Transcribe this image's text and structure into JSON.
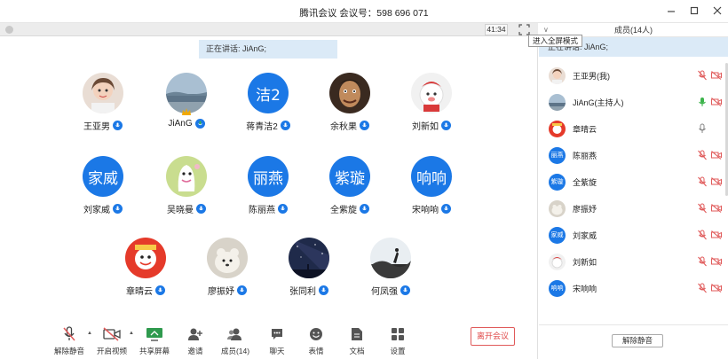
{
  "window": {
    "title": "腾讯会议  会议号：598 696 071"
  },
  "stage": {
    "timer": "41:34",
    "fullscreen_tooltip": "进入全屏模式",
    "speaking": "正在讲话: JiAnG;"
  },
  "participants": [
    {
      "name": "王亚男",
      "avatar": "photo-girl"
    },
    {
      "name": "JiAnG",
      "avatar": "photo-sea"
    },
    {
      "name": "蒋青洁2",
      "avatar_text": "洁2"
    },
    {
      "name": "余秋果",
      "avatar": "photo-man"
    },
    {
      "name": "刘新如",
      "avatar": "photo-lion"
    },
    {
      "name": "刘家威",
      "avatar_text": "家威"
    },
    {
      "name": "吴晓曼",
      "avatar": "photo-cartoon"
    },
    {
      "name": "陈丽燕",
      "avatar_text": "丽燕"
    },
    {
      "name": "全紫旋",
      "avatar_text": "紫璇"
    },
    {
      "name": "宋响响",
      "avatar_text": "响响"
    },
    {
      "name": "章晴云",
      "avatar": "photo-red"
    },
    {
      "name": "廖振妤",
      "avatar": "photo-bear"
    },
    {
      "name": "张同利",
      "avatar": "photo-stars"
    },
    {
      "name": "何凤强",
      "avatar": "photo-sunset"
    }
  ],
  "toolbar": {
    "mute": "解除静音",
    "video": "开启视频",
    "share": "共享屏幕",
    "invite": "邀请",
    "members": "成员(14)",
    "chat": "聊天",
    "emoji": "表情",
    "docs": "文档",
    "settings": "设置",
    "leave": "离开会议"
  },
  "side": {
    "header": "成员(14人)",
    "speaking": "正在讲话: JiAnG;",
    "unmute_all": "解除静音",
    "members": [
      {
        "name": "王亚男(我)",
        "avatar": "photo-girl"
      },
      {
        "name": "JiAnG(主持人)",
        "avatar": "photo-sea"
      },
      {
        "name": "章晴云",
        "avatar": "photo-red"
      },
      {
        "name": "陈丽燕",
        "avatar_text": "丽燕"
      },
      {
        "name": "全紫旋",
        "avatar_text": "紫璇"
      },
      {
        "name": "廖振妤",
        "avatar": "photo-bear"
      },
      {
        "name": "刘家威",
        "avatar_text": "家威"
      },
      {
        "name": "刘新如",
        "avatar": "photo-lion"
      },
      {
        "name": "宋响响",
        "avatar_text": "响响"
      }
    ]
  },
  "colors": {
    "accent": "#1b78e6",
    "speaking_bg": "#dbeaf7",
    "leave": "#e04a4a",
    "muted_red": "#e05a5a",
    "active_green": "#3cb44b"
  }
}
